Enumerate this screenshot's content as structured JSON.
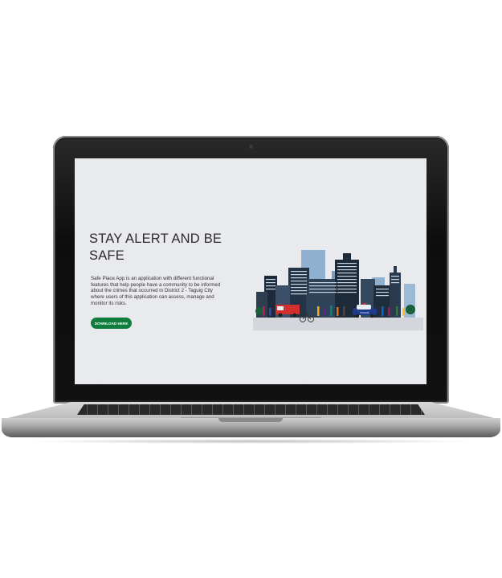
{
  "hero": {
    "title": "STAY ALERT AND BE SAFE",
    "description": "Safe Place App is an application with different functional features that help people have a community to be informed about the crimes that occurred in District 2 - Taguig City where users of this application can assess, manage and monitor its risks.",
    "download_button_label": "DOWNLOAD HERE"
  },
  "illustration": {
    "police_car_label": "POLICE"
  },
  "colors": {
    "accent": "#0f7d3b",
    "screen_bg": "#e9eaee",
    "building_dark": "#1d2a3a",
    "building_mid": "#3e5a77",
    "building_light": "#8fb1cf"
  }
}
